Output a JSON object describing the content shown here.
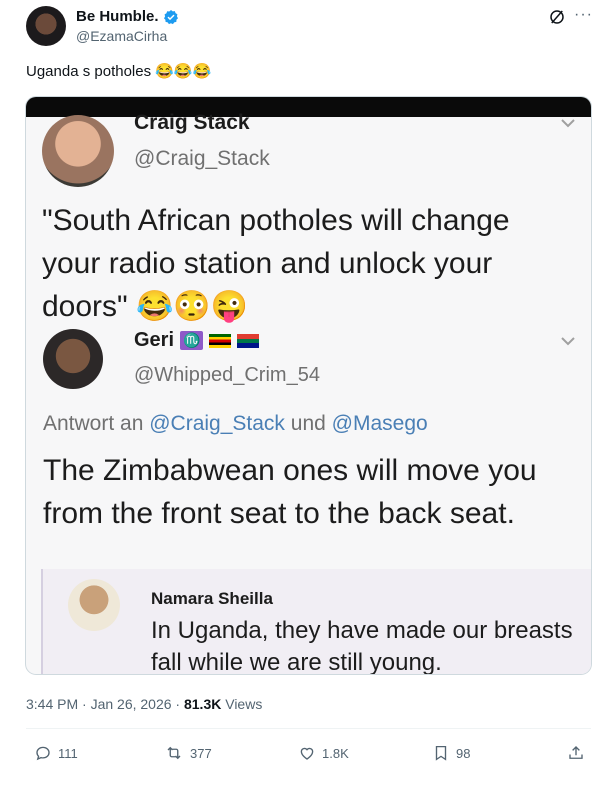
{
  "tweet": {
    "author": {
      "display_name": "Be Humble.",
      "handle": "@EzamaCirha",
      "verified": true
    },
    "text": "Uganda s potholes 😂😂😂",
    "timestamp": "3:44 PM · Jan 26, 2026 · ",
    "views_count": "81.3K",
    "views_label": " Views",
    "more_label": "···",
    "stats": {
      "replies": "111",
      "reposts": "377",
      "likes": "1.8K",
      "bookmarks": "98"
    }
  },
  "embedded_image": {
    "post1": {
      "name": "Craig Stack",
      "handle": "@Craig_Stack",
      "text": "\"South African potholes will change your radio station and unlock your doors\" 😂😳😜"
    },
    "post2": {
      "name": "Geri",
      "zodiac": "♏",
      "handle": "@Whipped_Crim_54",
      "reply_prefix": "Antwort an ",
      "reply_user1": "@Craig_Stack",
      "reply_and": " und ",
      "reply_user2": "@Masego",
      "text": "The Zimbabwean ones will move you from the front seat to the back seat."
    },
    "post3": {
      "name": "Namara Sheilla",
      "text": "In Uganda, they have made our breasts fall while we are still young."
    }
  },
  "colors": {
    "verified": "#1d9bf0",
    "link": "#4a7fb5",
    "muted": "#536471",
    "accent": "#0f1419"
  }
}
